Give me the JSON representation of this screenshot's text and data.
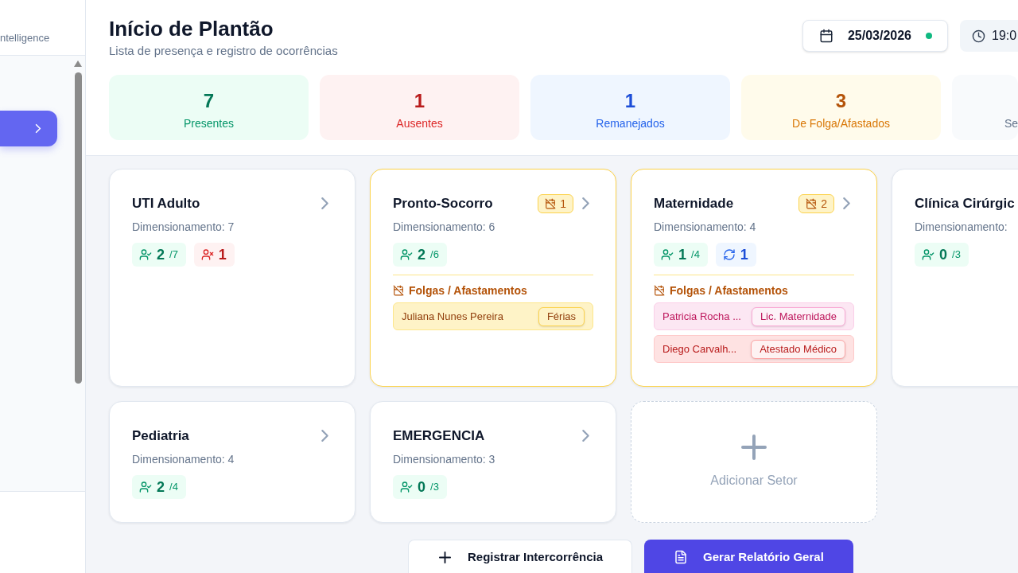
{
  "sidebar": {
    "brand_subtitle": "ntelligence",
    "items": [
      {
        "selected": true
      }
    ]
  },
  "header": {
    "title": "Início de Plantão",
    "subtitle": "Lista de presença e registro de ocorrências",
    "date": {
      "value": "25/03/2026",
      "live": true
    },
    "time": {
      "value": "19:0"
    }
  },
  "stats": [
    {
      "kind": "present",
      "value": "7",
      "label": "Presentes"
    },
    {
      "kind": "absent",
      "value": "1",
      "label": "Ausentes"
    },
    {
      "kind": "relocated",
      "value": "1",
      "label": "Remanejados"
    },
    {
      "kind": "leave",
      "value": "3",
      "label": "De Folga/Afastados"
    },
    {
      "kind": "other",
      "label": "Se"
    }
  ],
  "sectors": [
    {
      "title": "UTI Adulto",
      "sizing": "Dimensionamento: 7",
      "chevron": true,
      "counts": [
        {
          "kind": "present",
          "count": "2",
          "total": "/7"
        },
        {
          "kind": "absent",
          "count": "1"
        }
      ]
    },
    {
      "title": "Pronto-Socorro",
      "leave_badge": "1",
      "sizing": "Dimensionamento: 6",
      "chevron": true,
      "counts": [
        {
          "kind": "present",
          "count": "2",
          "total": "/6"
        }
      ],
      "leaves_heading": "Folgas / Afastamentos",
      "leaves": [
        {
          "kind": "vacation",
          "name": "Juliana Nunes Pereira",
          "type": "Férias"
        }
      ]
    },
    {
      "title": "Maternidade",
      "leave_badge": "2",
      "sizing": "Dimensionamento: 4",
      "chevron": true,
      "counts": [
        {
          "kind": "present",
          "count": "1",
          "total": "/4"
        },
        {
          "kind": "relocated",
          "count": "1"
        }
      ],
      "leaves_heading": "Folgas / Afastamentos",
      "leaves": [
        {
          "kind": "maternity",
          "name": "Patricia Rocha ...",
          "type": "Lic. Maternidade"
        },
        {
          "kind": "sick",
          "name": "Diego Carvalh...",
          "type": "Atestado Médico"
        }
      ]
    },
    {
      "title": "Clínica Cirúrgic",
      "sizing": "Dimensionamento:",
      "counts": [
        {
          "kind": "present",
          "count": "0",
          "total": "/3"
        }
      ]
    },
    {
      "title": "Pediatria",
      "sizing": "Dimensionamento: 4",
      "chevron": true,
      "counts": [
        {
          "kind": "present",
          "count": "2",
          "total": "/4"
        }
      ]
    },
    {
      "title": "EMERGENCIA",
      "sizing": "Dimensionamento: 3",
      "chevron": true,
      "counts": [
        {
          "kind": "present",
          "count": "0",
          "total": "/3"
        }
      ]
    }
  ],
  "add_sector": {
    "label": "Adicionar Setor"
  },
  "actions": [
    {
      "kind": "secondary",
      "label": "Registrar Intercorrência"
    },
    {
      "kind": "primary",
      "label": "Gerar Relatório Geral"
    }
  ]
}
